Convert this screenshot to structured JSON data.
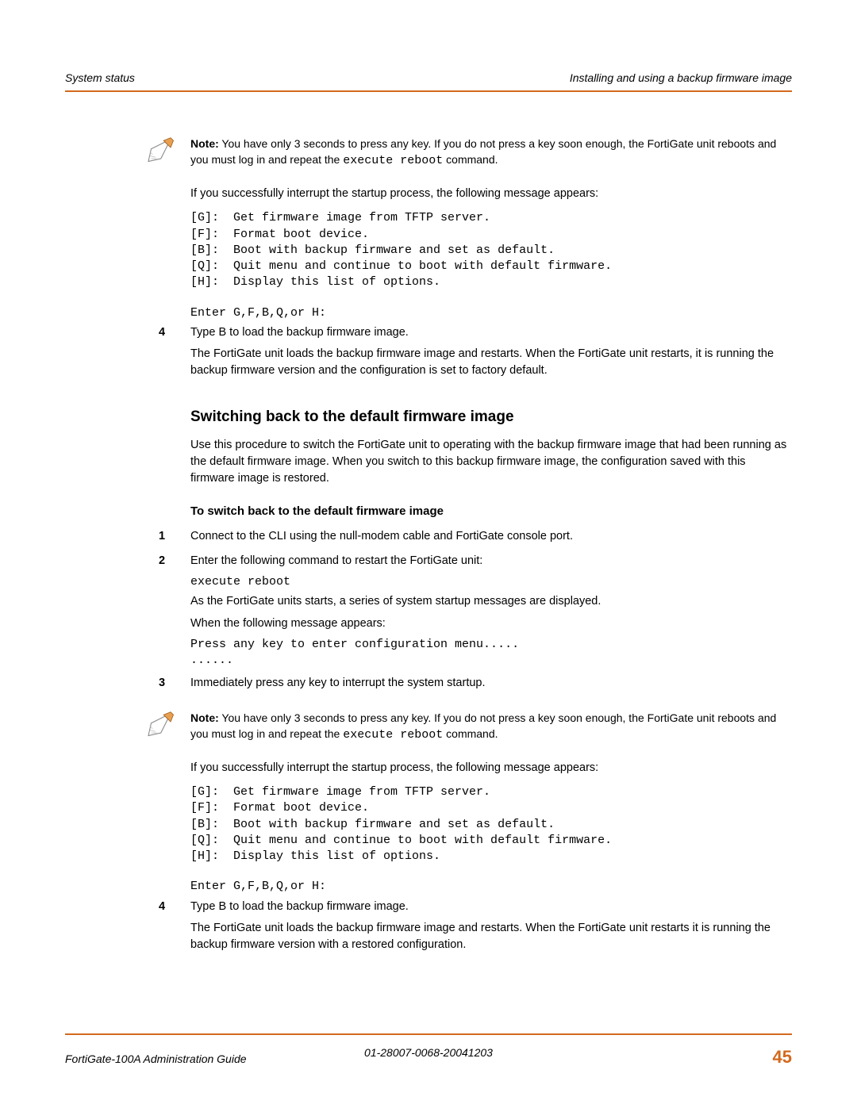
{
  "header": {
    "left": "System status",
    "right": "Installing and using a backup firmware image"
  },
  "note1": {
    "label": "Note:",
    "text_a": " You have only 3 seconds to press any key. If you do not press a key soon enough, the FortiGate unit reboots and you must log in and repeat the ",
    "cmd": "execute reboot",
    "text_b": " command."
  },
  "interrupt_msg": "If you successfully interrupt the startup process, the following message appears:",
  "menu_block": "[G]:  Get firmware image from TFTP server.\n[F]:  Format boot device.\n[B]:  Boot with backup firmware and set as default.\n[Q]:  Quit menu and continue to boot with default firmware.\n[H]:  Display this list of options.",
  "enter_prompt": "Enter G,F,B,Q,or H:",
  "step4a": {
    "num": "4",
    "line1": "Type B to load the backup firmware image.",
    "line2": "The FortiGate unit loads the backup firmware image and restarts. When the FortiGate unit restarts, it is running the backup firmware version and the configuration is set to factory default."
  },
  "h2": "Switching back to the default firmware image",
  "intro2": "Use this procedure to switch the FortiGate unit to operating with the backup firmware image that had been running as the default firmware image. When you switch to this backup firmware image, the configuration saved with this firmware image is restored.",
  "h3": "To switch back to the default firmware image",
  "step1": {
    "num": "1",
    "text": "Connect to the CLI using the null-modem cable and FortiGate console port."
  },
  "step2": {
    "num": "2",
    "line1": "Enter the following command to restart the FortiGate unit:",
    "cmd": "execute reboot",
    "line2": "As the FortiGate units starts, a series of system startup messages are displayed.",
    "line3": "When the following message appears:",
    "cmd2": "Press any key to enter configuration menu.....\n......"
  },
  "step3": {
    "num": "3",
    "text": "Immediately press any key to interrupt the system startup."
  },
  "note2": {
    "label": "Note:",
    "text_a": " You have only 3 seconds to press any key. If you do not press a key soon enough, the FortiGate unit reboots and you must log in and repeat the ",
    "cmd": "execute reboot",
    "text_b": " command."
  },
  "step4b": {
    "num": "4",
    "line1": "Type B to load the backup firmware image.",
    "line2": "The FortiGate unit loads the backup firmware image and restarts. When the FortiGate unit restarts it is running the backup firmware version with a restored configuration."
  },
  "footer": {
    "left": "FortiGate-100A Administration Guide",
    "center": "01-28007-0068-20041203",
    "page": "45"
  }
}
